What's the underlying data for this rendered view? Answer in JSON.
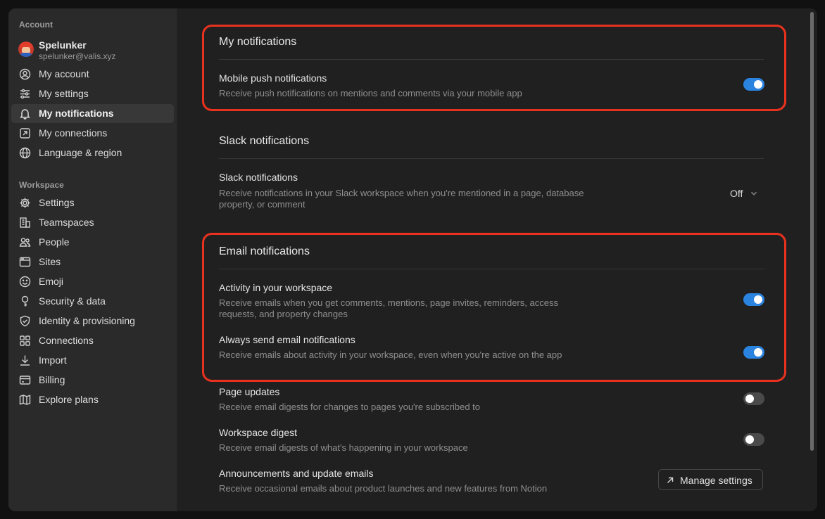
{
  "sidebar": {
    "account_label": "Account",
    "user": {
      "name": "Spelunker",
      "email": "spelunker@valis.xyz"
    },
    "account_items": [
      {
        "label": "My account",
        "icon": "user-circle-icon"
      },
      {
        "label": "My settings",
        "icon": "sliders-icon"
      },
      {
        "label": "My notifications",
        "icon": "bell-icon",
        "active": true
      },
      {
        "label": "My connections",
        "icon": "external-link-icon"
      },
      {
        "label": "Language & region",
        "icon": "globe-icon"
      }
    ],
    "workspace_label": "Workspace",
    "workspace_items": [
      {
        "label": "Settings",
        "icon": "gear-icon"
      },
      {
        "label": "Teamspaces",
        "icon": "building-icon"
      },
      {
        "label": "People",
        "icon": "people-icon"
      },
      {
        "label": "Sites",
        "icon": "browser-icon"
      },
      {
        "label": "Emoji",
        "icon": "smiley-icon"
      },
      {
        "label": "Security & data",
        "icon": "key-icon"
      },
      {
        "label": "Identity & provisioning",
        "icon": "shield-check-icon"
      },
      {
        "label": "Connections",
        "icon": "grid-icon"
      },
      {
        "label": "Import",
        "icon": "download-icon"
      },
      {
        "label": "Billing",
        "icon": "credit-card-icon"
      },
      {
        "label": "Explore plans",
        "icon": "map-icon"
      }
    ]
  },
  "main": {
    "my_notifications": {
      "title": "My notifications",
      "mobile_push": {
        "title": "Mobile push notifications",
        "desc": "Receive push notifications on mentions and comments via your mobile app",
        "on": true
      }
    },
    "slack": {
      "title": "Slack notifications",
      "row_title": "Slack notifications",
      "desc": "Receive notifications in your Slack workspace when you're mentioned in a page, database property, or comment",
      "value": "Off"
    },
    "email": {
      "title": "Email notifications",
      "activity": {
        "title": "Activity in your workspace",
        "desc": "Receive emails when you get comments, mentions, page invites, reminders, access requests, and property changes",
        "on": true
      },
      "always_send": {
        "title": "Always send email notifications",
        "desc": "Receive emails about activity in your workspace, even when you're active on the app",
        "on": true
      },
      "page_updates": {
        "title": "Page updates",
        "desc": "Receive email digests for changes to pages you're subscribed to",
        "on": false
      },
      "workspace_digest": {
        "title": "Workspace digest",
        "desc": "Receive email digests of what's happening in your workspace",
        "on": false
      },
      "announcements": {
        "title": "Announcements and update emails",
        "desc": "Receive occasional emails about product launches and new features from Notion",
        "button_label": "Manage settings"
      }
    }
  },
  "colors": {
    "accent": "#2b83e0",
    "highlight": "#e8321f"
  }
}
